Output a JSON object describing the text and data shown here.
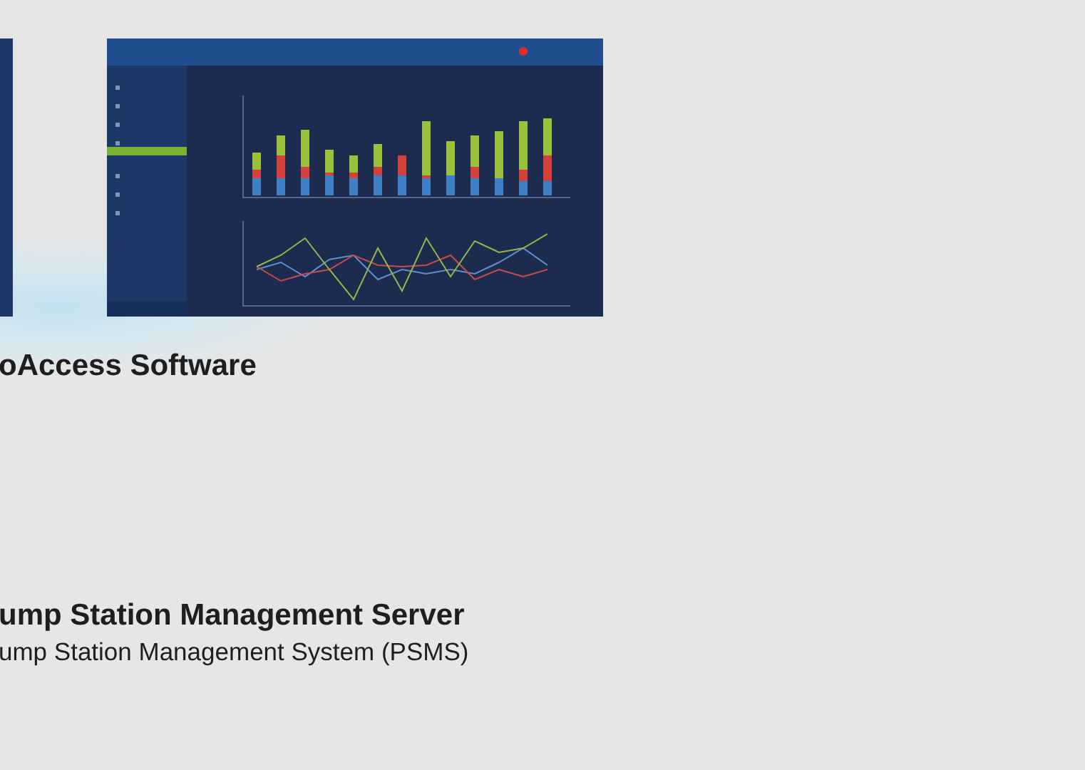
{
  "sections": [
    {
      "title": "oAccess Software"
    },
    {
      "title": "ump Station Management Server",
      "subtitle": "ump Station Management System (PSMS)"
    }
  ]
}
